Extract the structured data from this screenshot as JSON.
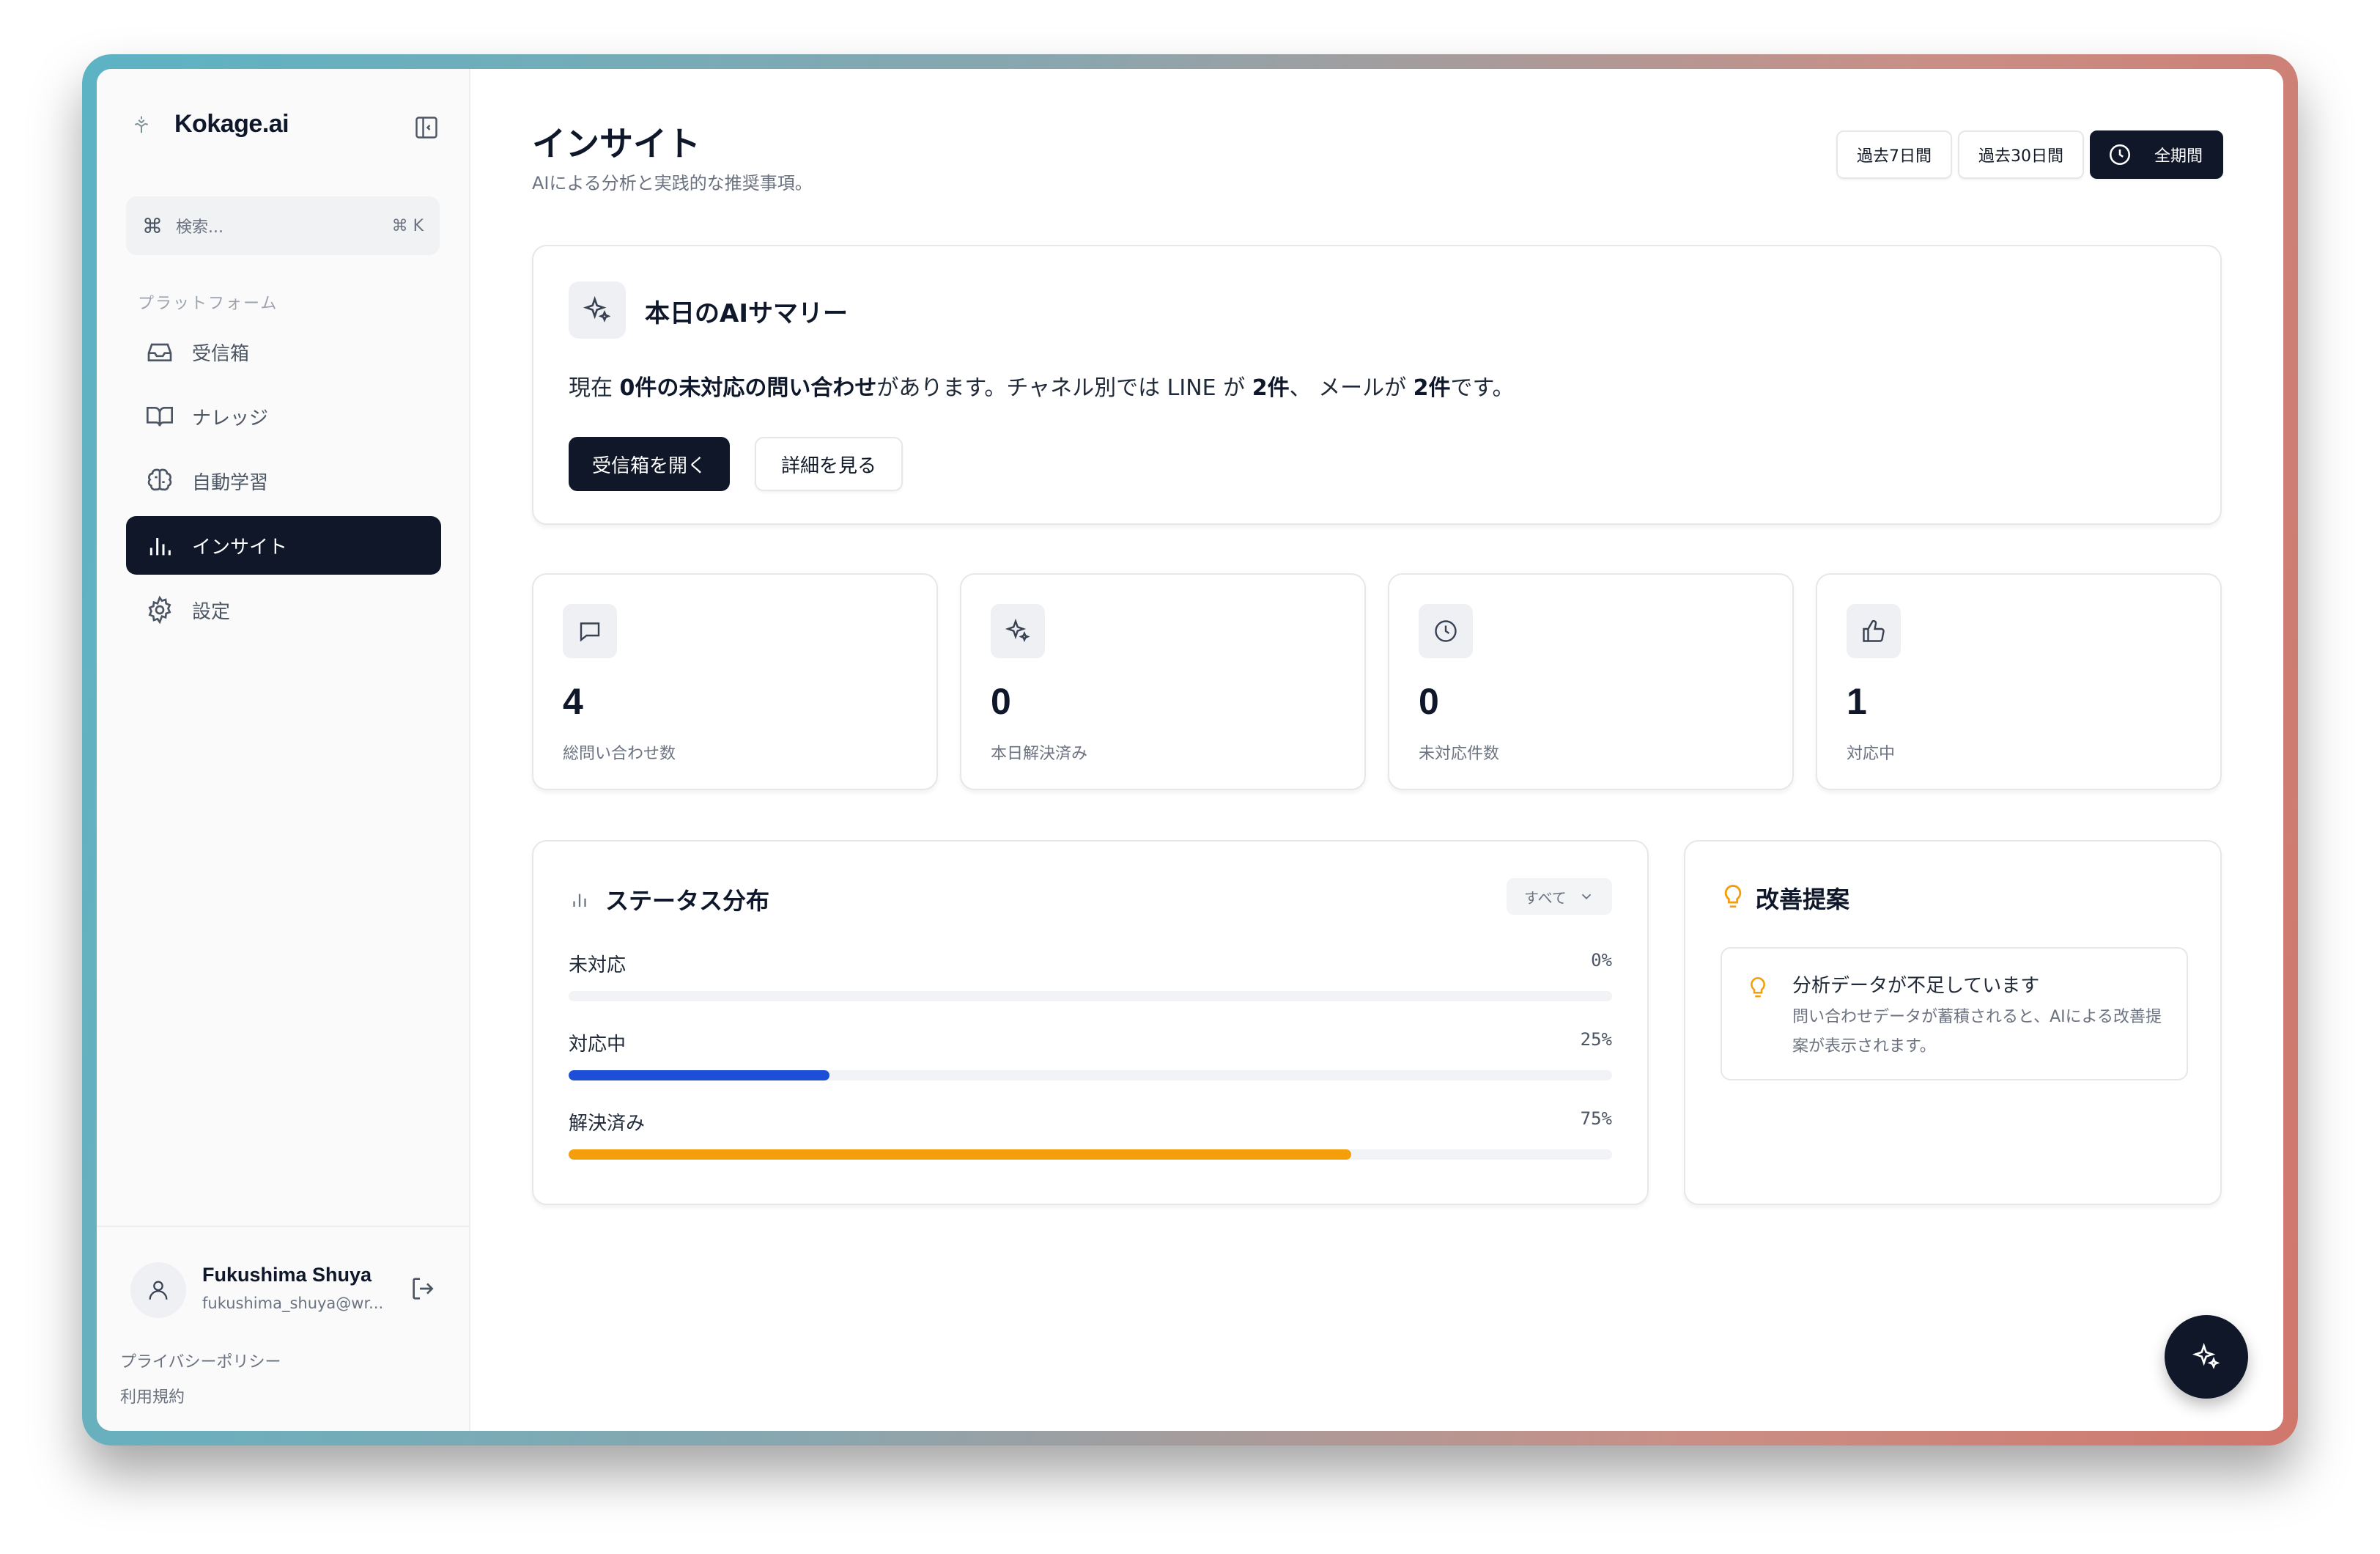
{
  "sidebar": {
    "brand": "Kokage.ai",
    "search": {
      "placeholder": "検索...",
      "shortcut": "⌘ K"
    },
    "section": "プラットフォーム",
    "items": [
      {
        "label": "受信箱",
        "icon": "inbox-icon",
        "active": false
      },
      {
        "label": "ナレッジ",
        "icon": "book-icon",
        "active": false
      },
      {
        "label": "自動学習",
        "icon": "brain-icon",
        "active": false
      },
      {
        "label": "インサイト",
        "icon": "bar-chart-icon",
        "active": true
      },
      {
        "label": "設定",
        "icon": "gear-icon",
        "active": false
      }
    ],
    "user": {
      "name": "Fukushima Shuya",
      "email": "fukushima_shuya@wr..."
    },
    "links": {
      "privacy": "プライバシーポリシー",
      "terms": "利用規約"
    }
  },
  "header": {
    "title": "インサイト",
    "subtitle": "AIによる分析と実践的な推奨事項。",
    "ranges": [
      "過去7日間",
      "過去30日間",
      "全期間"
    ],
    "active_range": "全期間"
  },
  "summary": {
    "title": "本日のAIサマリー",
    "text": {
      "p1": "現在 ",
      "b1": "0件の未対応の問い合わせ",
      "p2": "があります。チャネル別では LINE が ",
      "b2": "2件",
      "p3": "、 メールが ",
      "b3": "2件",
      "p4": "です。"
    },
    "primary_button": "受信箱を開く",
    "secondary_button": "詳細を見る"
  },
  "stats": [
    {
      "value": "4",
      "label": "総問い合わせ数",
      "icon": "message-icon"
    },
    {
      "value": "0",
      "label": "本日解決済み",
      "icon": "sparkles-icon"
    },
    {
      "value": "0",
      "label": "未対応件数",
      "icon": "clock-icon"
    },
    {
      "value": "1",
      "label": "対応中",
      "icon": "thumbs-up-icon"
    }
  ],
  "status": {
    "title": "ステータス分布",
    "filter": "すべて",
    "rows": [
      {
        "name": "未対応",
        "percent_label": "0%",
        "value": 0,
        "color": "#2563eb"
      },
      {
        "name": "対応中",
        "percent_label": "25%",
        "value": 25,
        "color": "#1d4ed8"
      },
      {
        "name": "解決済み",
        "percent_label": "75%",
        "value": 75,
        "color": "#f59e0b"
      }
    ]
  },
  "improvements": {
    "title": "改善提案",
    "item_title": "分析データが不足しています",
    "item_desc": "問い合わせデータが蓄積されると、AIによる改善提案が表示されます。"
  },
  "colors": {
    "primary": "#0f1729",
    "accent_blue": "#1d4ed8",
    "accent_orange": "#f59e0b",
    "bulb": "#f59e0b"
  }
}
